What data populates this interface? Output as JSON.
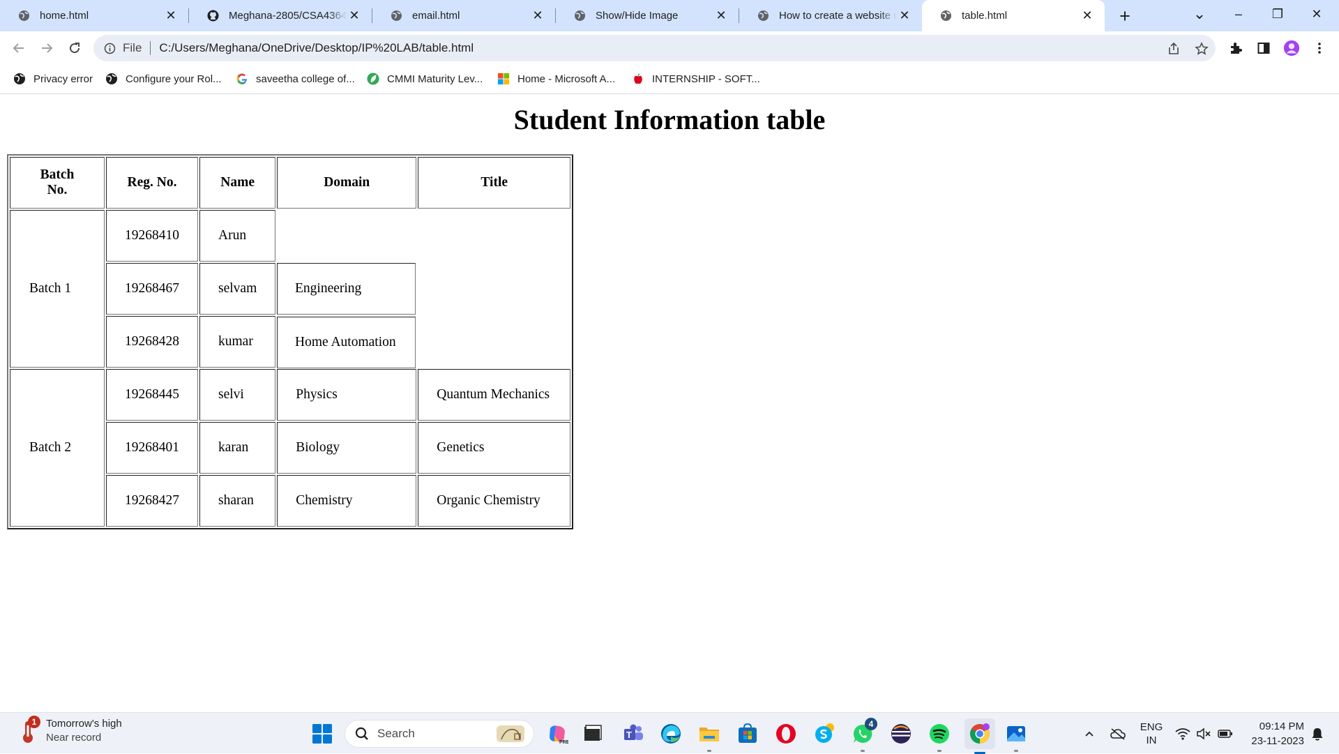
{
  "browser": {
    "tabs": [
      {
        "title": "home.html",
        "favicon": "globe-icon",
        "active": false
      },
      {
        "title": "Meghana-2805/CSA4364-IP",
        "favicon": "github-icon",
        "active": false
      },
      {
        "title": "email.html",
        "favicon": "globe-icon",
        "active": false
      },
      {
        "title": "Show/Hide Image",
        "favicon": "globe-icon",
        "active": false
      },
      {
        "title": "How to create a website using",
        "favicon": "globe-icon",
        "active": false
      },
      {
        "title": "table.html",
        "favicon": "globe-icon",
        "active": true
      }
    ],
    "new_tab_glyph": "+",
    "window_controls": {
      "tab_search": "⌄",
      "minimize": "–",
      "restore": "❐",
      "close": "✕"
    },
    "address": {
      "scheme_chip": "File",
      "url": "C:/Users/Meghana/OneDrive/Desktop/IP%20LAB/table.html"
    },
    "bookmarks": [
      {
        "label": "Privacy error",
        "icon": "globe-icon"
      },
      {
        "label": "Configure your Rol...",
        "icon": "globe-icon"
      },
      {
        "label": "saveetha college of...",
        "icon": "google-icon"
      },
      {
        "label": "CMMI Maturity Lev...",
        "icon": "leaf-icon"
      },
      {
        "label": "Home - Microsoft A...",
        "icon": "microsoft-icon"
      },
      {
        "label": "INTERNSHIP - SOFT...",
        "icon": "apple-icon"
      }
    ],
    "accent_color": "#d3e3fd"
  },
  "page": {
    "heading": "Student Information table",
    "table": {
      "headers": [
        "Batch No.",
        "Reg. No.",
        "Name",
        "Domain",
        "Title"
      ],
      "batches": [
        {
          "label": "Batch 1",
          "rows": [
            {
              "reg": "19268410",
              "name": "Arun",
              "domain": "",
              "title": ""
            },
            {
              "reg": "19268467",
              "name": "selvam",
              "domain": "Engineering",
              "title": ""
            },
            {
              "reg": "19268428",
              "name": "kumar",
              "domain": "Home Automation",
              "title": ""
            }
          ]
        },
        {
          "label": "Batch 2",
          "rows": [
            {
              "reg": "19268445",
              "name": "selvi",
              "domain": "Physics",
              "title": "Quantum Mechanics"
            },
            {
              "reg": "19268401",
              "name": "karan",
              "domain": "Biology",
              "title": "Genetics"
            },
            {
              "reg": "19268427",
              "name": "sharan",
              "domain": "Chemistry",
              "title": "Organic Chemistry"
            }
          ]
        }
      ]
    }
  },
  "taskbar": {
    "weather": {
      "title": "Tomorrow's high",
      "subtitle": "Near record",
      "badge": "1"
    },
    "search_label": "Search",
    "apps": [
      "copilot-icon",
      "file-manager-icon",
      "teams-icon",
      "edge-icon",
      "file-explorer-icon",
      "store-icon",
      "opera-icon",
      "skype-icon",
      "whatsapp-icon",
      "eclipse-icon",
      "spotify-icon",
      "chrome-icon",
      "photos-icon"
    ],
    "whatsapp_badge": "4",
    "tray": {
      "language_top": "ENG",
      "language_bottom": "IN"
    },
    "clock": {
      "time": "09:14 PM",
      "date": "23-11-2023"
    }
  }
}
